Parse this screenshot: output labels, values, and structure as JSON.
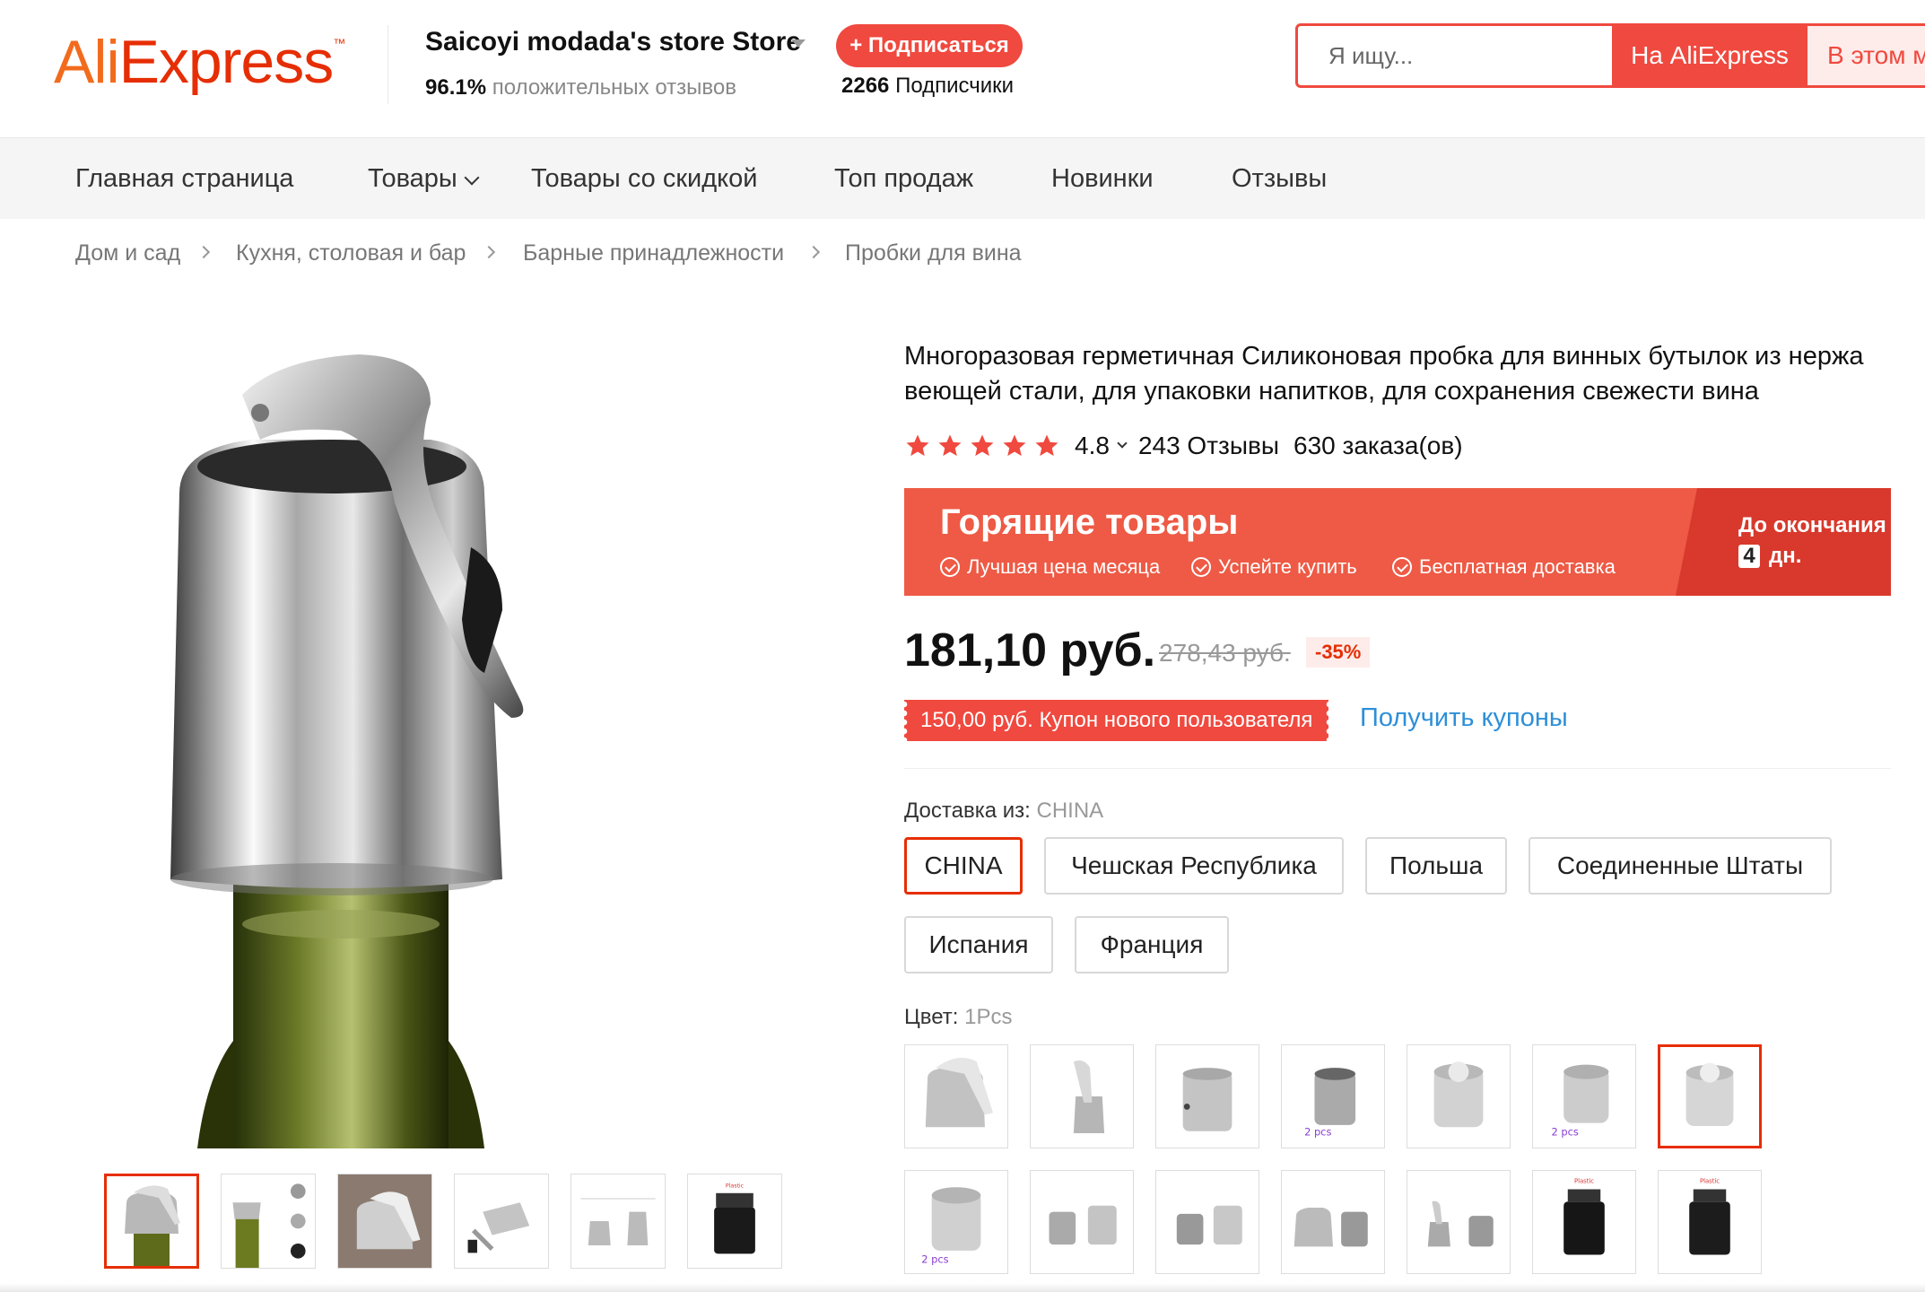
{
  "header": {
    "logo_text": "AliExpress",
    "store_name": "Saicoyi modada's store Store",
    "feedback_percent": "96.1%",
    "feedback_label": "положительных отзывов",
    "follow_button": "+ Подписаться",
    "followers_count": "2266",
    "followers_label": "Подписчики",
    "search_placeholder": "Я ищу...",
    "search_ali_button": "На AliExpress",
    "search_store_button": "В этом м"
  },
  "nav": {
    "items": [
      "Главная страница",
      "Товары",
      "Товары со скидкой",
      "Топ продаж",
      "Новинки",
      "Отзывы"
    ]
  },
  "breadcrumb": [
    "Дом и сад",
    "Кухня, столовая и бар",
    "Барные принадлежности",
    "Пробки для вина"
  ],
  "product": {
    "title": "Многоразовая герметичная Силиконовая пробка для винных бутылок из нержа веющей стали, для упаковки напитков, для сохранения свежести вина",
    "rating": "4.8",
    "rating_stars": 5,
    "reviews": "243 Отзывы",
    "orders": "630 заказа(ов)",
    "hot": {
      "title": "Горящие товары",
      "features": [
        "Лучшая цена месяца",
        "Успейте купить",
        "Бесплатная доставка"
      ],
      "until_label": "До окончания",
      "days_num": "4",
      "days_label": "дн."
    },
    "price": "181,10 руб.",
    "old_price": "278,43 руб.",
    "discount": "-35%",
    "coupon": "150,00 руб. Купон нового пользователя",
    "get_coupons": "Получить купоны",
    "shipping_label": "Доставка из:",
    "shipping_selected": "CHINA",
    "shipping_options": [
      "CHINA",
      "Чешская Республика",
      "Польша",
      "Соединенные Штаты",
      "Испания",
      "Франция"
    ],
    "color_label": "Цвет:",
    "color_selected": "1Pcs"
  },
  "colors": {
    "accent": "#f0493f",
    "brand_orange": "#f26b1d",
    "link": "#2e8fd8",
    "hot_banner": "#ee5a45"
  }
}
